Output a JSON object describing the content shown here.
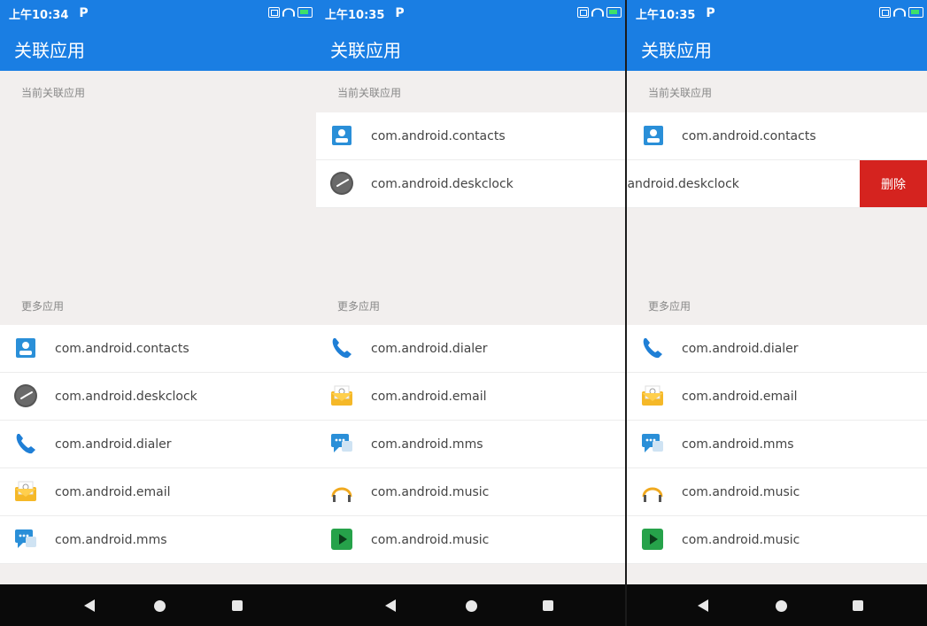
{
  "status": {
    "time": "上午10:34",
    "time2": "上午10:35",
    "p_icon": "P"
  },
  "title": "关联应用",
  "section_current": "当前关联应用",
  "section_more": "更多应用",
  "screen1": {
    "more_apps": [
      {
        "name": "com.android.contacts",
        "icon": "contacts-icon"
      },
      {
        "name": "com.android.deskclock",
        "icon": "clock-icon"
      },
      {
        "name": "com.android.dialer",
        "icon": "phone-icon"
      },
      {
        "name": "com.android.email",
        "icon": "email-icon"
      },
      {
        "name": "com.android.mms",
        "icon": "mms-icon"
      }
    ]
  },
  "screen2": {
    "current_apps": [
      {
        "name": "com.android.contacts",
        "icon": "contacts-icon"
      },
      {
        "name": "com.android.deskclock",
        "icon": "clock-icon"
      }
    ],
    "more_apps": [
      {
        "name": "com.android.dialer",
        "icon": "phone-icon"
      },
      {
        "name": "com.android.email",
        "icon": "email-icon"
      },
      {
        "name": "com.android.mms",
        "icon": "mms-icon"
      },
      {
        "name": "com.android.music",
        "icon": "headphones-icon"
      },
      {
        "name": "com.android.music",
        "icon": "play-icon"
      }
    ]
  },
  "screen3": {
    "current_apps": [
      {
        "name": "com.android.contacts",
        "icon": "contacts-icon"
      },
      {
        "name": ".android.deskclock",
        "icon": ""
      }
    ],
    "delete_label": "删除",
    "more_apps": [
      {
        "name": "com.android.dialer",
        "icon": "phone-icon"
      },
      {
        "name": "com.android.email",
        "icon": "email-icon"
      },
      {
        "name": "com.android.mms",
        "icon": "mms-icon"
      },
      {
        "name": "com.android.music",
        "icon": "headphones-icon"
      },
      {
        "name": "com.android.music",
        "icon": "play-icon"
      }
    ]
  },
  "colors": {
    "primary": "#1a7ee3",
    "delete": "#d5231f",
    "background": "#f2efee"
  }
}
